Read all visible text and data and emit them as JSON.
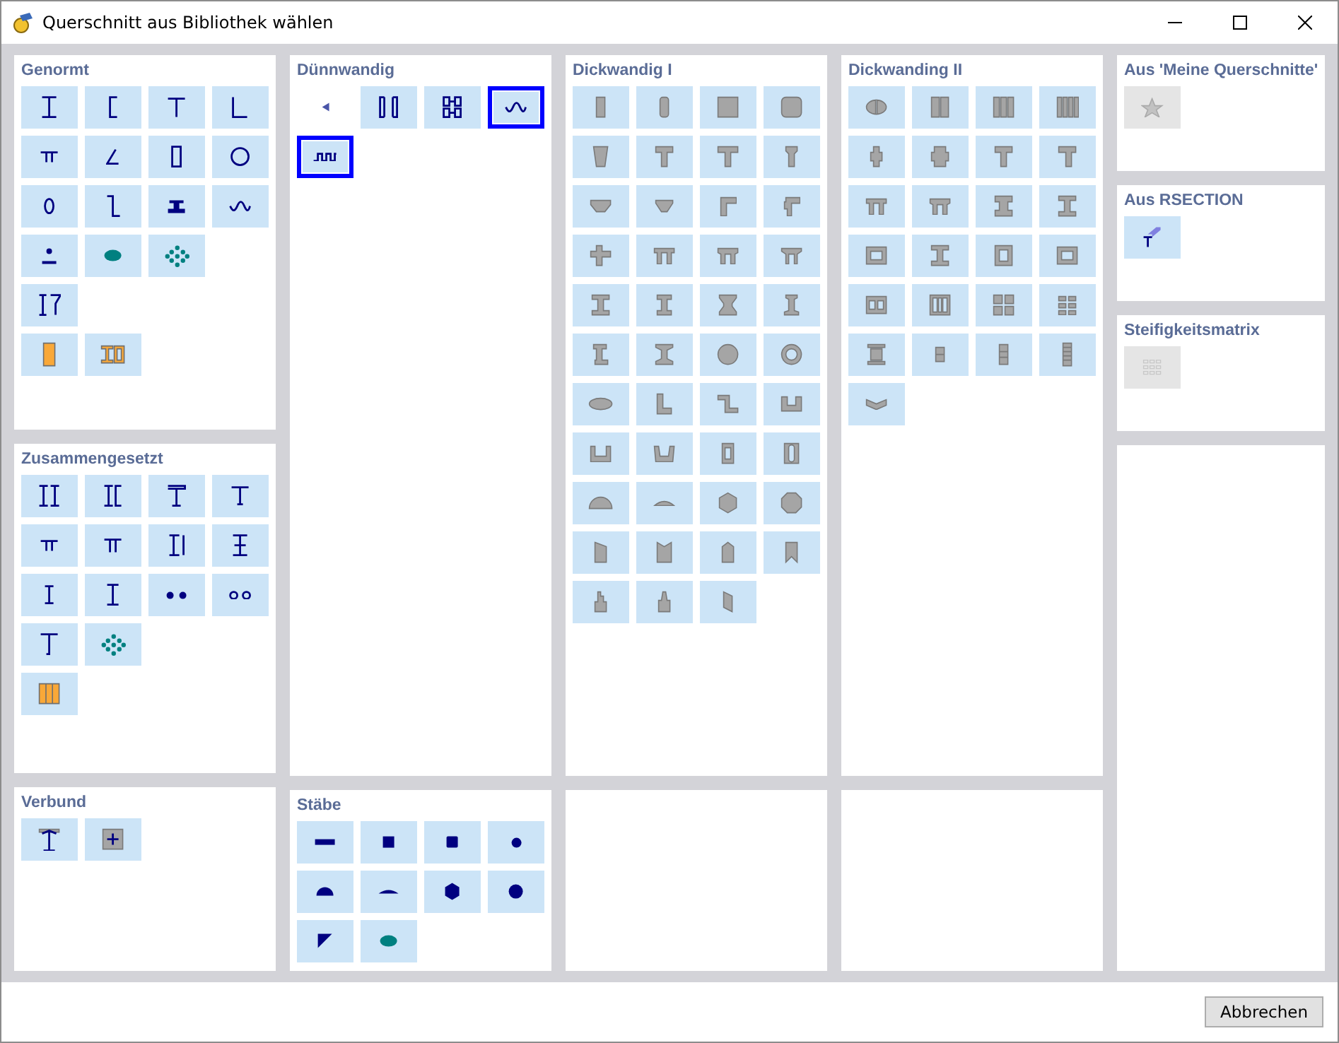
{
  "window": {
    "title": "Querschnitt aus Bibliothek wählen"
  },
  "columns": [
    {
      "panels": [
        {
          "title": "Genormt",
          "rows": [
            [
              {
                "selected": false,
                "disabled": false
              },
              {
                "selected": false,
                "disabled": false
              },
              {
                "selected": false,
                "disabled": false
              },
              {
                "selected": false,
                "disabled": false
              }
            ],
            [
              {
                "selected": false,
                "disabled": false
              },
              {
                "selected": false,
                "disabled": false
              },
              {
                "selected": false,
                "disabled": false
              },
              {
                "selected": false,
                "disabled": false
              }
            ],
            [
              {
                "selected": false,
                "disabled": false
              },
              {
                "selected": false,
                "disabled": false
              },
              {
                "selected": false,
                "disabled": false
              },
              {
                "selected": false,
                "disabled": false
              }
            ],
            [
              {
                "selected": false,
                "disabled": false
              },
              {
                "selected": false,
                "disabled": false
              },
              {
                "selected": false,
                "disabled": false
              }
            ],
            [
              {
                "selected": false,
                "disabled": false
              }
            ],
            [
              {
                "selected": false,
                "disabled": false
              },
              {
                "selected": false,
                "disabled": false
              }
            ]
          ]
        },
        {
          "title": "Zusammengesetzt",
          "rows": [
            [
              {
                "selected": false,
                "disabled": false
              },
              {
                "selected": false,
                "disabled": false
              },
              {
                "selected": false,
                "disabled": false
              },
              {
                "selected": false,
                "disabled": false
              }
            ],
            [
              {
                "selected": false,
                "disabled": false
              },
              {
                "selected": false,
                "disabled": false
              },
              {
                "selected": false,
                "disabled": false
              },
              {
                "selected": false,
                "disabled": false
              }
            ],
            [
              {
                "selected": false,
                "disabled": false
              },
              {
                "selected": false,
                "disabled": false
              },
              {
                "selected": false,
                "disabled": false
              },
              {
                "selected": false,
                "disabled": false
              }
            ],
            [
              {
                "selected": false,
                "disabled": false
              },
              {
                "selected": false,
                "disabled": false
              }
            ],
            [
              {
                "selected": false,
                "disabled": false
              }
            ]
          ]
        },
        {
          "title": "Verbund",
          "rows": [
            [
              {
                "selected": false,
                "disabled": false
              },
              {
                "selected": false,
                "disabled": false
              }
            ]
          ]
        }
      ]
    },
    {
      "panels": [
        {
          "title": "Dünnwandig",
          "rows": [
            [
              {
                "kind": "nav",
                "selected": false,
                "disabled": false
              },
              {
                "kind": "section",
                "selected": false,
                "disabled": false
              },
              {
                "kind": "section",
                "selected": false,
                "disabled": false
              },
              {
                "kind": "section",
                "selected": true,
                "disabled": false
              }
            ],
            [
              {
                "kind": "section",
                "selected": true,
                "disabled": false
              }
            ]
          ]
        },
        {
          "title": "Stäbe",
          "rows": [
            [
              {
                "selected": false,
                "disabled": false
              },
              {
                "selected": false,
                "disabled": false
              },
              {
                "selected": false,
                "disabled": false
              },
              {
                "selected": false,
                "disabled": false
              }
            ],
            [
              {
                "selected": false,
                "disabled": false
              },
              {
                "selected": false,
                "disabled": false
              },
              {
                "selected": false,
                "disabled": false
              },
              {
                "selected": false,
                "disabled": false
              }
            ],
            [
              {
                "selected": false,
                "disabled": false
              },
              {
                "selected": false,
                "disabled": false
              }
            ]
          ]
        }
      ]
    },
    {
      "panels": [
        {
          "title": "Dickwandig I",
          "rows": [
            [
              {
                "selected": false,
                "disabled": false
              },
              {
                "selected": false,
                "disabled": false
              },
              {
                "selected": false,
                "disabled": false
              },
              {
                "selected": false,
                "disabled": false
              }
            ],
            [
              {
                "selected": false,
                "disabled": false
              },
              {
                "selected": false,
                "disabled": false
              },
              {
                "selected": false,
                "disabled": false
              },
              {
                "selected": false,
                "disabled": false
              }
            ],
            [
              {
                "selected": false,
                "disabled": false
              },
              {
                "selected": false,
                "disabled": false
              },
              {
                "selected": false,
                "disabled": false
              },
              {
                "selected": false,
                "disabled": false
              }
            ],
            [
              {
                "selected": false,
                "disabled": false
              },
              {
                "selected": false,
                "disabled": false
              },
              {
                "selected": false,
                "disabled": false
              },
              {
                "selected": false,
                "disabled": false
              }
            ],
            [
              {
                "selected": false,
                "disabled": false
              },
              {
                "selected": false,
                "disabled": false
              },
              {
                "selected": false,
                "disabled": false
              },
              {
                "selected": false,
                "disabled": false
              }
            ],
            [
              {
                "selected": false,
                "disabled": false
              },
              {
                "selected": false,
                "disabled": false
              },
              {
                "selected": false,
                "disabled": false
              },
              {
                "selected": false,
                "disabled": false
              }
            ],
            [
              {
                "selected": false,
                "disabled": false
              },
              {
                "selected": false,
                "disabled": false
              },
              {
                "selected": false,
                "disabled": false
              },
              {
                "selected": false,
                "disabled": false
              }
            ],
            [
              {
                "selected": false,
                "disabled": false
              },
              {
                "selected": false,
                "disabled": false
              },
              {
                "selected": false,
                "disabled": false
              },
              {
                "selected": false,
                "disabled": false
              }
            ],
            [
              {
                "selected": false,
                "disabled": false
              },
              {
                "selected": false,
                "disabled": false
              },
              {
                "selected": false,
                "disabled": false
              },
              {
                "selected": false,
                "disabled": false
              }
            ],
            [
              {
                "selected": false,
                "disabled": false
              },
              {
                "selected": false,
                "disabled": false
              },
              {
                "selected": false,
                "disabled": false
              },
              {
                "selected": false,
                "disabled": false
              }
            ],
            [
              {
                "selected": false,
                "disabled": false
              },
              {
                "selected": false,
                "disabled": false
              },
              {
                "selected": false,
                "disabled": false
              }
            ]
          ]
        }
      ]
    },
    {
      "panels": [
        {
          "title": "Dickwanding II",
          "rows": [
            [
              {
                "selected": false,
                "disabled": false
              },
              {
                "selected": false,
                "disabled": false
              },
              {
                "selected": false,
                "disabled": false
              },
              {
                "selected": false,
                "disabled": false
              }
            ],
            [
              {
                "selected": false,
                "disabled": false
              },
              {
                "selected": false,
                "disabled": false
              },
              {
                "selected": false,
                "disabled": false
              },
              {
                "selected": false,
                "disabled": false
              }
            ],
            [
              {
                "selected": false,
                "disabled": false
              },
              {
                "selected": false,
                "disabled": false
              },
              {
                "selected": false,
                "disabled": false
              },
              {
                "selected": false,
                "disabled": false
              }
            ],
            [
              {
                "selected": false,
                "disabled": false
              },
              {
                "selected": false,
                "disabled": false
              },
              {
                "selected": false,
                "disabled": false
              },
              {
                "selected": false,
                "disabled": false
              }
            ],
            [
              {
                "selected": false,
                "disabled": false
              },
              {
                "selected": false,
                "disabled": false
              },
              {
                "selected": false,
                "disabled": false
              },
              {
                "selected": false,
                "disabled": false
              }
            ],
            [
              {
                "selected": false,
                "disabled": false
              },
              {
                "selected": false,
                "disabled": false
              },
              {
                "selected": false,
                "disabled": false
              },
              {
                "selected": false,
                "disabled": false
              }
            ],
            [
              {
                "selected": false,
                "disabled": false
              }
            ]
          ]
        }
      ]
    },
    {
      "panels": [
        {
          "title": "Aus 'Meine Querschnitte'",
          "rows": [
            [
              {
                "selected": false,
                "disabled": true
              }
            ]
          ]
        },
        {
          "title": "Aus RSECTION",
          "rows": [
            [
              {
                "selected": false,
                "disabled": false
              }
            ]
          ]
        },
        {
          "title": "Steifigkeitsmatrix",
          "rows": [
            [
              {
                "selected": false,
                "disabled": true
              }
            ]
          ]
        }
      ]
    }
  ],
  "buttons": [
    "Abbrechen"
  ]
}
